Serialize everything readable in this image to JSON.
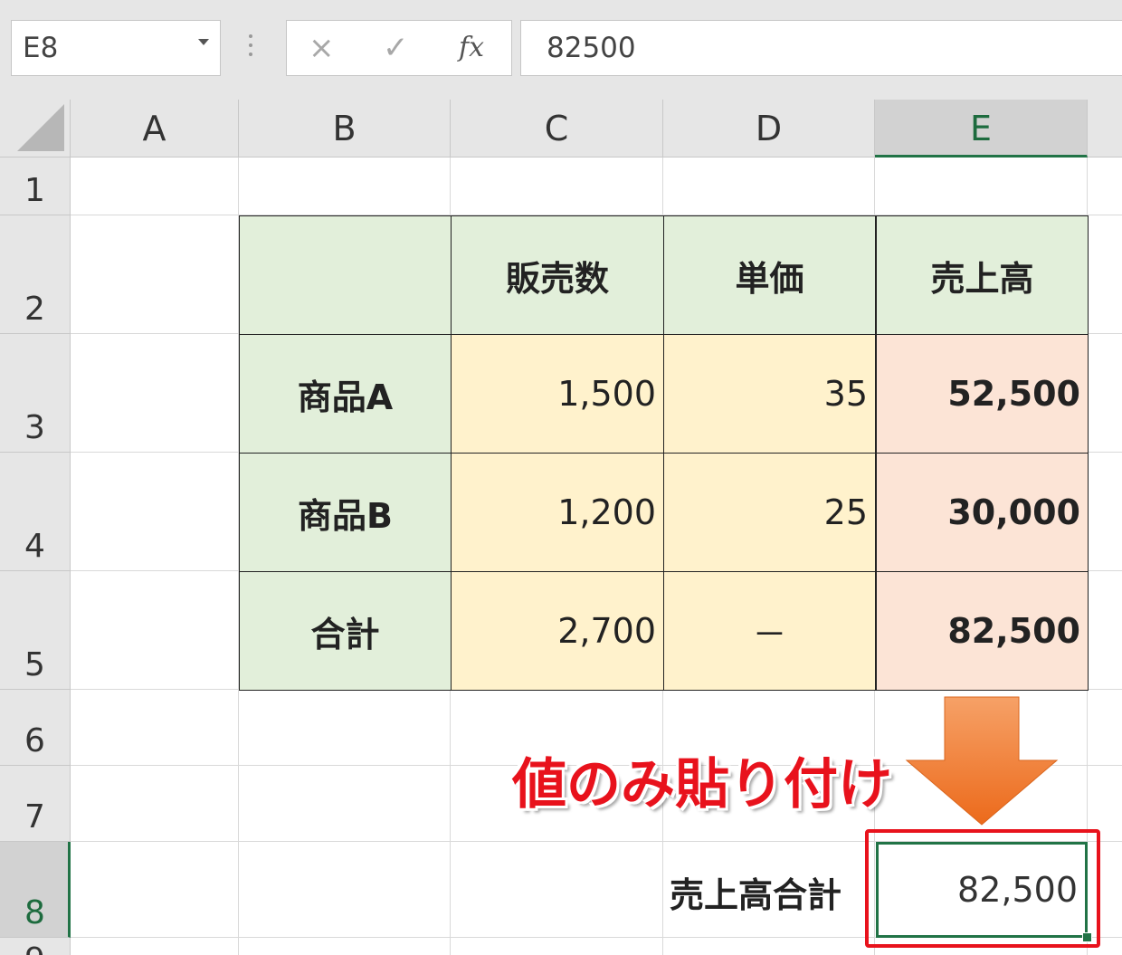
{
  "formula_bar": {
    "name_box": "E8",
    "formula": "82500",
    "cancel_icon": "×",
    "enter_icon": "✓",
    "fx_icon": "fx"
  },
  "columns": [
    "A",
    "B",
    "C",
    "D",
    "E"
  ],
  "rows": [
    "1",
    "2",
    "3",
    "4",
    "5",
    "6",
    "7",
    "8",
    "9"
  ],
  "selected_cell": "E8",
  "table": {
    "headers": [
      "",
      "販売数",
      "単価",
      "売上高"
    ],
    "rows": [
      {
        "label": "商品A",
        "qty": "1,500",
        "price": "35",
        "sales": "52,500"
      },
      {
        "label": "商品B",
        "qty": "1,200",
        "price": "25",
        "sales": "30,000"
      },
      {
        "label": "合計",
        "qty": "2,700",
        "price": "－",
        "sales": "82,500"
      }
    ]
  },
  "result": {
    "label": "売上高合計",
    "value": "82,500"
  },
  "annotation": {
    "text": "値のみ貼り付け",
    "color": "#e8121c",
    "arrow_color": "#f07d2b"
  },
  "colors": {
    "header_fill": "#e2efda",
    "number_fill": "#fff2cc",
    "total_fill": "#fce4d6",
    "selection": "#217346"
  }
}
